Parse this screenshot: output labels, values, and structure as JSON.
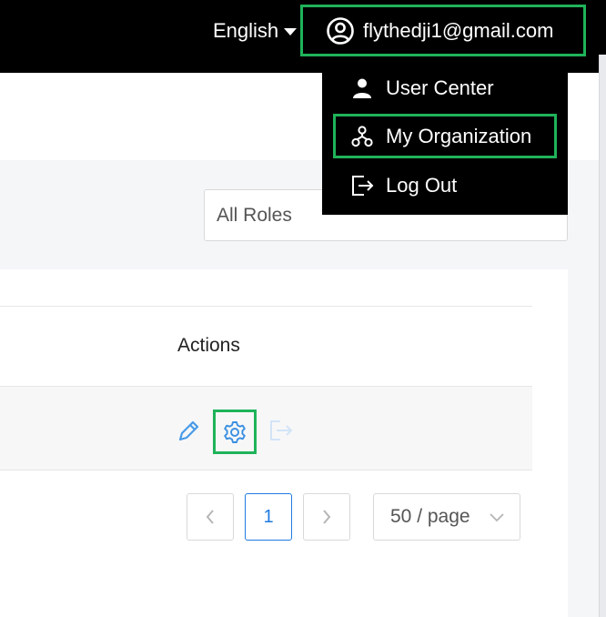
{
  "header": {
    "language_label": "English",
    "account_email": "flythedji1@gmail.com"
  },
  "account_menu": {
    "items": [
      {
        "label": "User Center",
        "icon": "user-icon"
      },
      {
        "label": "My Organization",
        "icon": "organization-icon"
      },
      {
        "label": "Log Out",
        "icon": "logout-icon"
      }
    ]
  },
  "filters": {
    "role_select_value": "All Roles"
  },
  "table": {
    "headers": {
      "actions": "Actions"
    },
    "row_actions": [
      "edit-icon",
      "settings-gear-icon",
      "exit-icon"
    ]
  },
  "pagination": {
    "current_page": "1",
    "page_size": "50 / page"
  },
  "colors": {
    "highlight": "#1fb35a",
    "accent": "#1f7ae0",
    "header_bg": "#000000"
  }
}
